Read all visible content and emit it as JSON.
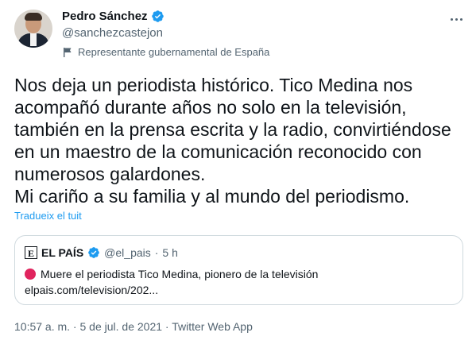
{
  "author": {
    "name": "Pedro Sánchez",
    "handle": "@sanchezcastejon",
    "label": "Representante gubernamental de España"
  },
  "tweet": {
    "text": "Nos deja un periodista histórico. Tico Medina nos\nacompañó durante años no solo en la televisión,\ntambién en la prensa escrita y la radio, convirtiéndose\nen un maestro de la comunicación reconocido con\nnumerosos galardones.\nMi cariño a su familia y al mundo del periodismo.",
    "translate_label": "Tradueix el tuit"
  },
  "quoted": {
    "name": "EL PAÍS",
    "handle": "@el_pais",
    "separator": "·",
    "time": "5 h",
    "headline": "Muere el periodista Tico Medina, pionero de la televisión",
    "link": "elpais.com/television/202..."
  },
  "meta": "10:57 a. m. · 5 de jul. de 2021 · Twitter Web App",
  "colors": {
    "accent": "#1d9bf0",
    "text": "#0f1419",
    "secondary": "#536471"
  },
  "icons": [
    "verified-icon",
    "more-icon",
    "flag-icon",
    "red-circle-icon"
  ]
}
